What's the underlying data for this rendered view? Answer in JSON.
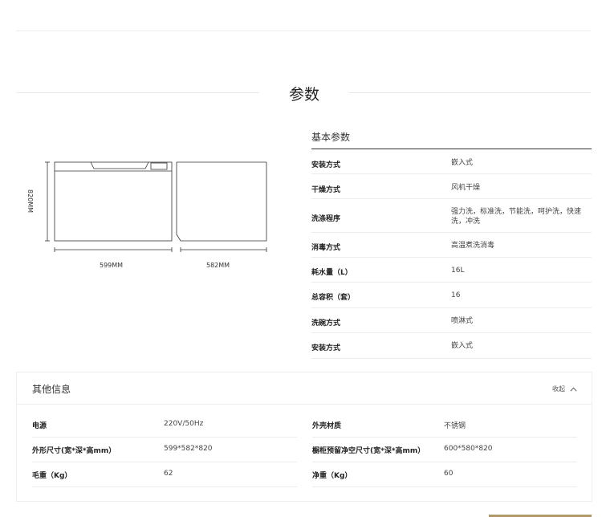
{
  "section": {
    "title": "参数"
  },
  "drawing": {
    "height_label": "820MM",
    "width_label": "599MM",
    "depth_label": "582MM"
  },
  "params": {
    "header": "基本参数",
    "rows": [
      {
        "key": "安装方式",
        "value": "嵌入式"
      },
      {
        "key": "干燥方式",
        "value": "风机干燥"
      },
      {
        "key": "洗涤程序",
        "value": "强力洗，标准洗，节能洗，呵护洗，快速洗，冲洗"
      },
      {
        "key": "消毒方式",
        "value": "高温煮洗消毒"
      },
      {
        "key": "耗水量（L）",
        "value": "16L"
      },
      {
        "key": "总容积（套）",
        "value": "16"
      },
      {
        "key": "洗碗方式",
        "value": "喷淋式"
      },
      {
        "key": "安装方式",
        "value": "嵌入式"
      }
    ]
  },
  "other": {
    "title": "其他信息",
    "toggle_label": "收起",
    "rows": [
      {
        "key": "电源",
        "value": "220V/50Hz"
      },
      {
        "key": "外壳材质",
        "value": "不锈钢"
      },
      {
        "key": "外形尺寸(宽*深*高mm）",
        "value": "599*582*820"
      },
      {
        "key": "橱柜预留净空尺寸(宽*深*高mm）",
        "value": "600*580*820"
      },
      {
        "key": "毛重（Kg）",
        "value": "62"
      },
      {
        "key": "净重（Kg）",
        "value": "60"
      }
    ]
  },
  "icons": {
    "toggle": "chevron-up-icon"
  },
  "colors": {
    "accent": "#b09a6a"
  }
}
